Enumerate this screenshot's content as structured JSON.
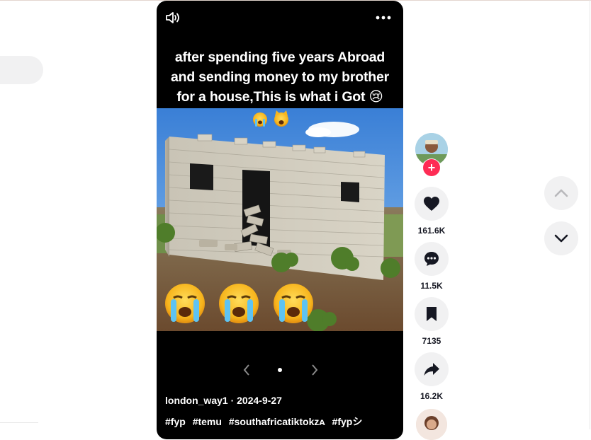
{
  "video": {
    "caption_lines": [
      "after spending five years Abroad",
      "and sending money to my brother",
      "for a house,This is what i Got 😢"
    ],
    "caption_emojis": "😭 🙀",
    "author": "london_way1",
    "separator": " · ",
    "date": "2024-9-27",
    "hashtags": [
      "#fyp",
      "#temu",
      "#southafricatiktokᴢᴀ",
      "#fypシ"
    ]
  },
  "actions": {
    "likes": "161.6K",
    "comments": "11.5K",
    "saves": "7135",
    "shares": "16.2K",
    "follow_label": "+"
  },
  "colors": {
    "follow": "#fe2c55",
    "action_bg": "#f1f1f2",
    "player_bg": "#000000"
  },
  "icons": [
    "volume-icon",
    "more-icon",
    "heart-icon",
    "comment-icon",
    "bookmark-icon",
    "share-icon",
    "chevron-up-icon",
    "chevron-down-icon",
    "chevron-left-icon",
    "chevron-right-icon"
  ]
}
